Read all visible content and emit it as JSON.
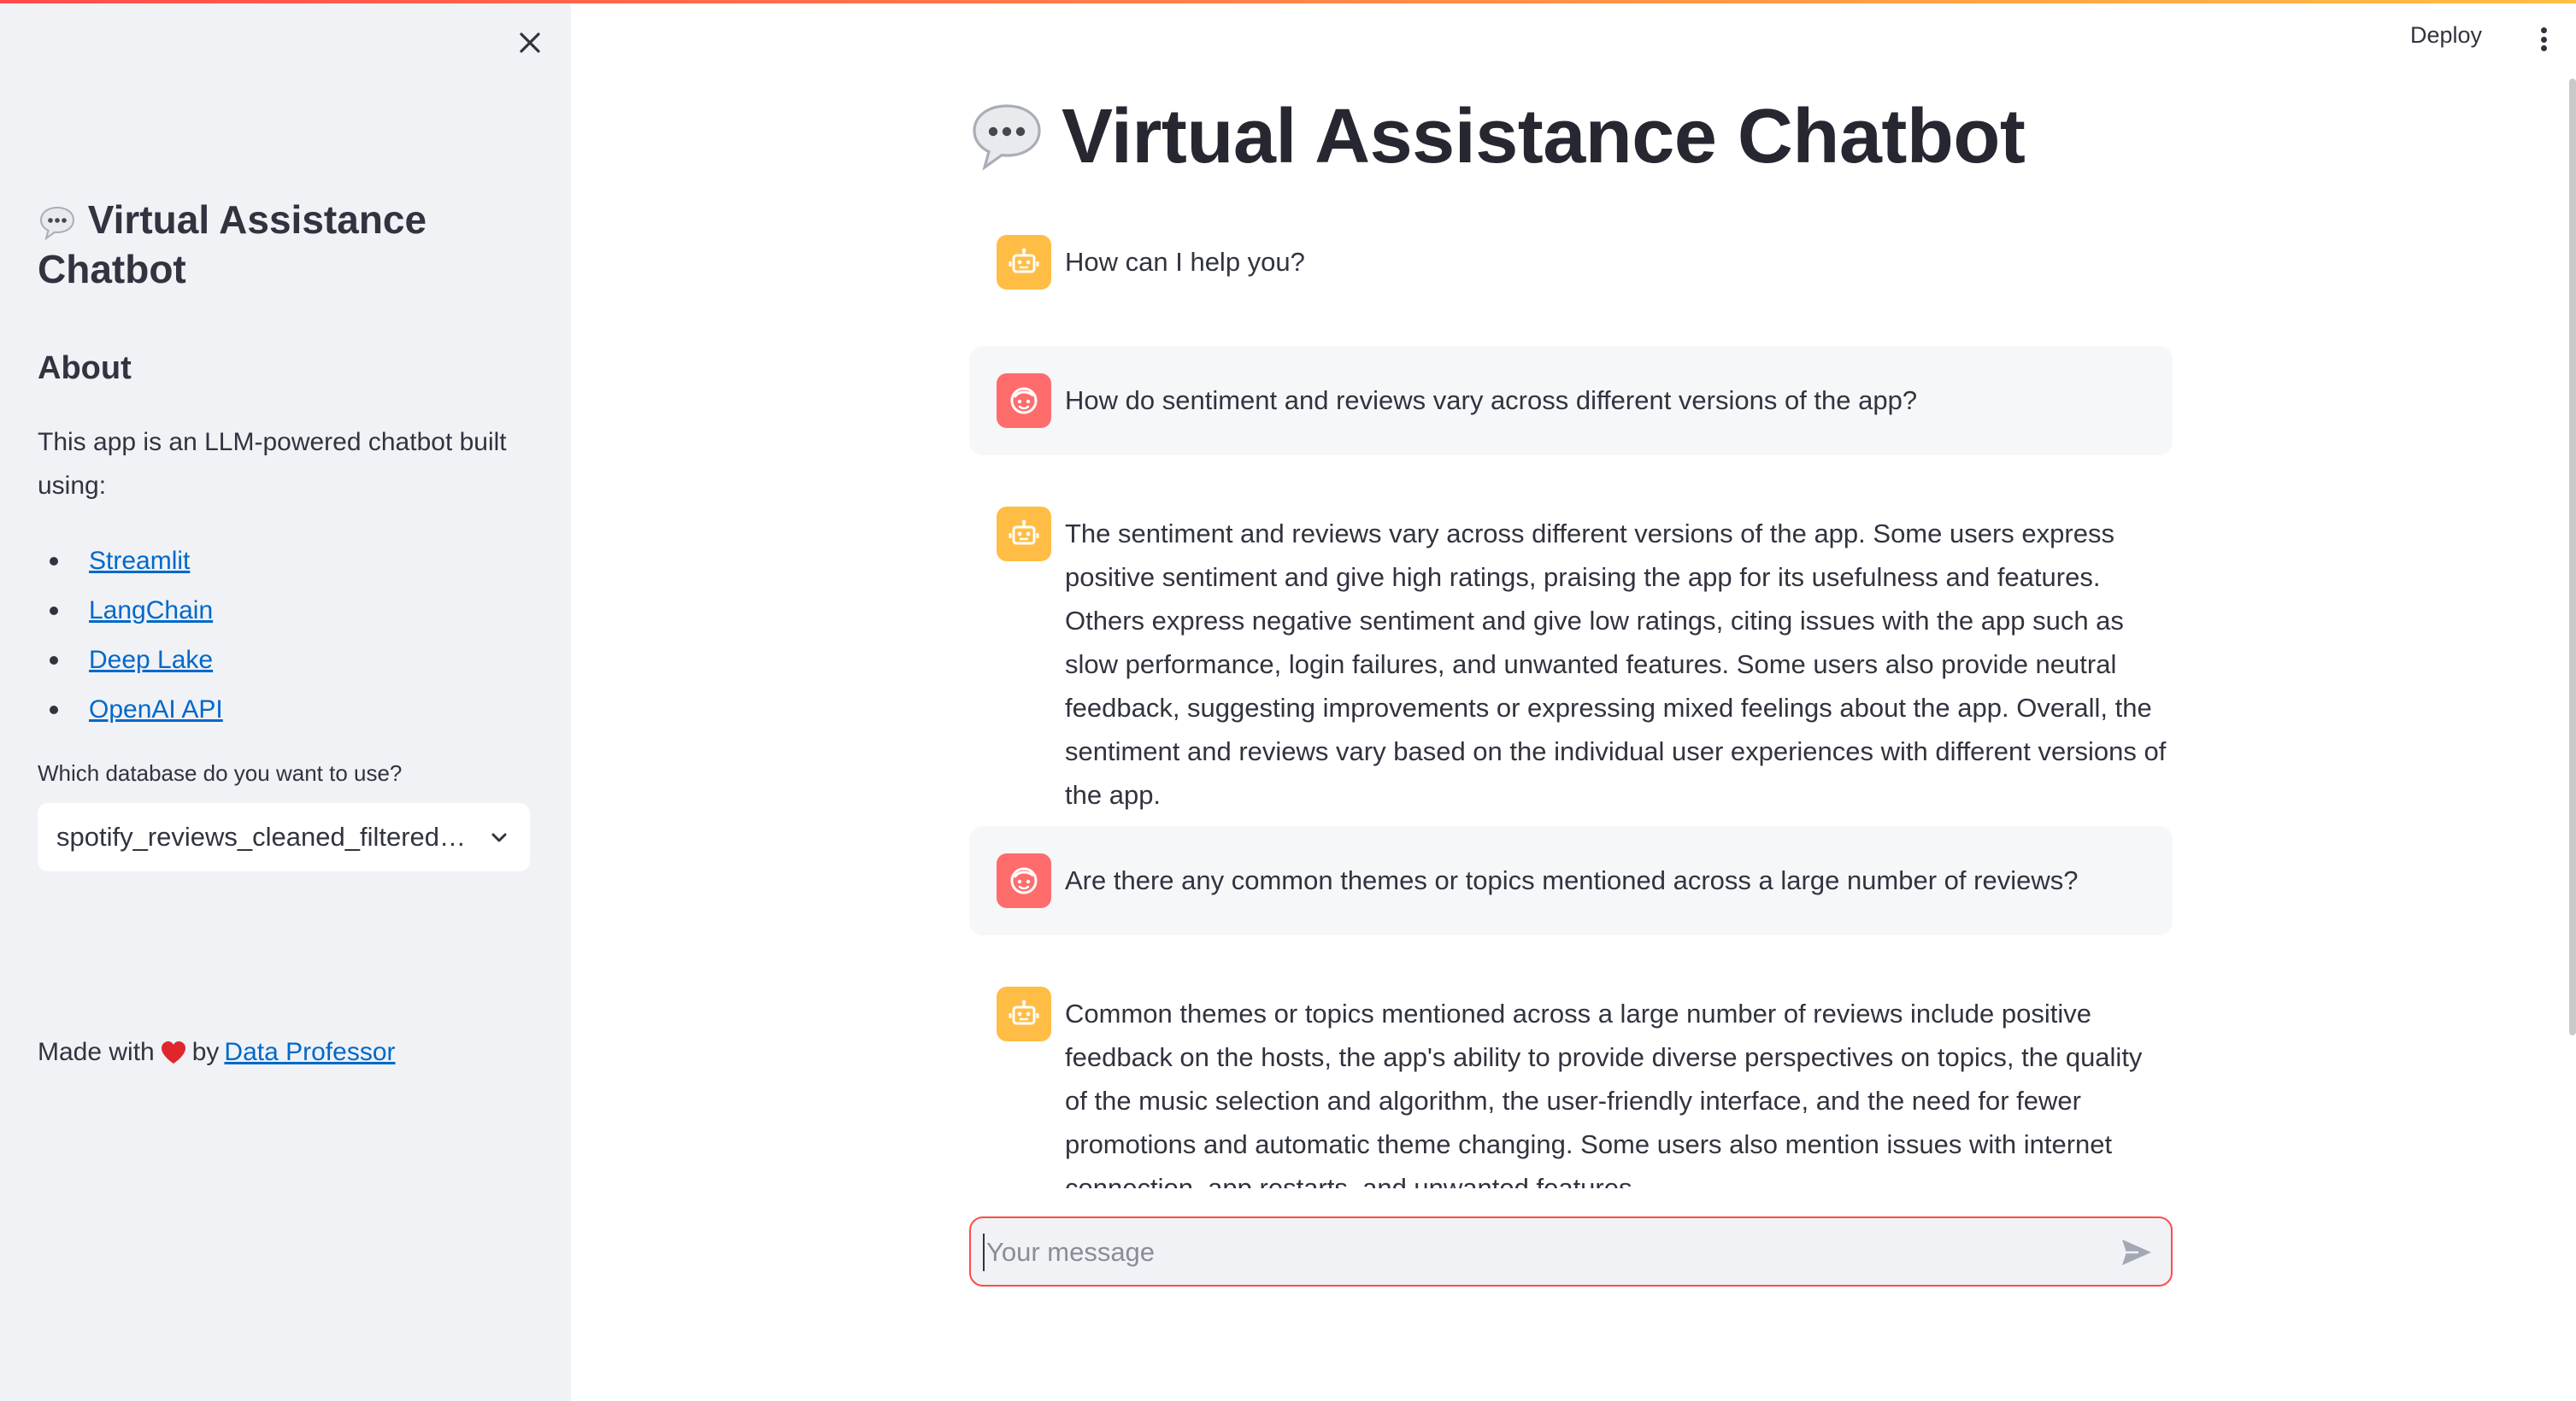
{
  "sidebar": {
    "title": "Virtual Assistance Chatbot",
    "about_heading": "About",
    "description": "This app is an LLM-powered chatbot built using:",
    "links": [
      {
        "label": "Streamlit"
      },
      {
        "label": "LangChain"
      },
      {
        "label": "Deep Lake"
      },
      {
        "label": "OpenAI API"
      }
    ],
    "select_label": "Which database do you want to use?",
    "select_value": "spotify_reviews_cleaned_filtered_embeddings",
    "footer_prefix": "Made with",
    "footer_by": "by",
    "footer_link": "Data Professor"
  },
  "header": {
    "deploy_label": "Deploy"
  },
  "main": {
    "title": "Virtual Assistance Chatbot",
    "messages": [
      {
        "role": "assistant",
        "text": "How can I help you?"
      },
      {
        "role": "user",
        "text": "How do sentiment and reviews vary across different versions of the app?"
      },
      {
        "role": "assistant",
        "text": "The sentiment and reviews vary across different versions of the app. Some users express positive sentiment and give high ratings, praising the app for its usefulness and features. Others express negative sentiment and give low ratings, citing issues with the app such as slow performance, login failures, and unwanted features. Some users also provide neutral feedback, suggesting improvements or expressing mixed feelings about the app. Overall, the sentiment and reviews vary based on the individual user experiences with different versions of the app."
      },
      {
        "role": "user",
        "text": "Are there any common themes or topics mentioned across a large number of reviews?"
      },
      {
        "role": "assistant",
        "text": "Common themes or topics mentioned across a large number of reviews include positive feedback on the hosts, the app's ability to provide diverse perspectives on topics, the quality of the music selection and algorithm, the user-friendly interface, and the need for fewer promotions and automatic theme changing. Some users also mention issues with internet connection, app restarts, and unwanted features."
      }
    ],
    "input_placeholder": "Your message"
  },
  "colors": {
    "accent": "#ff4b4b",
    "bot_avatar": "#ffbd45",
    "user_avatar": "#ff6c6c",
    "link": "#0068c9",
    "sidebar_bg": "#f0f2f6"
  },
  "icons": {
    "sidebar_close": "close-icon",
    "title_emoji": "speech-bubble-icon",
    "select_chevron": "chevron-down-icon",
    "bot_avatar": "robot-icon",
    "user_avatar": "face-icon",
    "send": "send-icon",
    "menu": "kebab-menu-icon",
    "heart": "heart-icon"
  }
}
